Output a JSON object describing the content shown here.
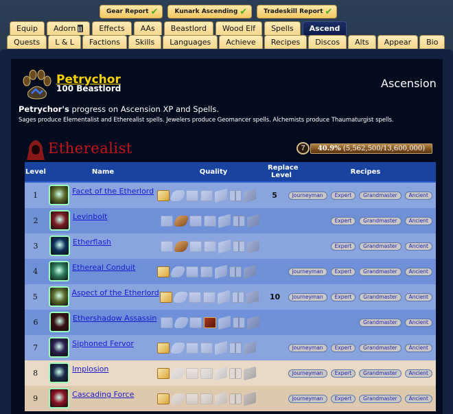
{
  "reports": [
    {
      "label": "Gear Report",
      "status": "check"
    },
    {
      "label": "Kunark Ascending",
      "status": "check"
    },
    {
      "label": "Tradeskill Report",
      "status": "check"
    }
  ],
  "tabs_row1": [
    {
      "label": "Equip"
    },
    {
      "label": "Adorn",
      "icon": "calculator-icon"
    },
    {
      "label": "Effects"
    },
    {
      "label": "AAs"
    },
    {
      "label": "Beastlord"
    },
    {
      "label": "Wood Elf"
    },
    {
      "label": "Spells"
    },
    {
      "label": "Ascend",
      "active": true
    }
  ],
  "tabs_row2": [
    {
      "label": "Quests"
    },
    {
      "label": "L & L"
    },
    {
      "label": "Factions"
    },
    {
      "label": "Skills"
    },
    {
      "label": "Languages"
    },
    {
      "label": "Achieve"
    },
    {
      "label": "Recipes"
    },
    {
      "label": "Discos"
    },
    {
      "label": "Alts"
    },
    {
      "label": "Appear"
    },
    {
      "label": "Bio"
    }
  ],
  "character": {
    "name": "Petrychor",
    "subtitle": "100 Beastlord"
  },
  "page_title": "Ascension",
  "progress_line": {
    "owner": "Petrychor's",
    "rest": " progress on Ascension XP and Spells."
  },
  "description": "Sages produce Elementalist and Etherealist spells. Jewelers produce Geomancer spells. Alchemists produce Thaumaturgist spells.",
  "ascension_class": {
    "name": "Etherealist",
    "level": "7",
    "xp_percent_label": "40.9%",
    "xp_detail": "(5,562,500/13,600,000)",
    "xp_fraction": 0.409
  },
  "table": {
    "headers": {
      "level": "Level",
      "name": "Name",
      "quality": "Quality",
      "replace": "Replace Level",
      "recipes": "Recipes"
    },
    "quality_icons": [
      "scroll-icon",
      "roll-icon",
      "tome-icon",
      "parchment-icon",
      "tablet-icon",
      "book-icon",
      "slab-icon"
    ],
    "rows": [
      {
        "level": "1",
        "name": "Facet of the Etherlord",
        "quality": 0,
        "replace": "5",
        "recipes": [
          "Journeyman",
          "Expert",
          "Grandmaster",
          "Ancient"
        ],
        "shade": "a",
        "icon_color": "#5a6a2a"
      },
      {
        "level": "2",
        "name": "Levinbolt",
        "quality": 1,
        "replace": "",
        "recipes": [
          "Expert",
          "Grandmaster",
          "Ancient"
        ],
        "shade": "b",
        "icon_color": "#7a1a20"
      },
      {
        "level": "3",
        "name": "Etherflash",
        "quality": 1,
        "replace": "",
        "recipes": [
          "Expert",
          "Grandmaster",
          "Ancient"
        ],
        "shade": "a",
        "icon_color": "#10305a"
      },
      {
        "level": "4",
        "name": "Ethereal Conduit",
        "quality": 0,
        "replace": "",
        "recipes": [
          "Journeyman",
          "Expert",
          "Grandmaster",
          "Ancient"
        ],
        "shade": "b",
        "icon_color": "#2a7a5a"
      },
      {
        "level": "5",
        "name": "Aspect of the Etherlord",
        "quality": 0,
        "replace": "10",
        "recipes": [
          "Journeyman",
          "Expert",
          "Grandmaster",
          "Ancient"
        ],
        "shade": "a",
        "icon_color": "#5a6a2a"
      },
      {
        "level": "6",
        "name": "Ethershadow Assassin",
        "quality": 3,
        "replace": "",
        "recipes": [
          "Grandmaster",
          "Ancient"
        ],
        "shade": "b",
        "icon_color": "#3a1010"
      },
      {
        "level": "7",
        "name": "Siphoned Fervor",
        "quality": 0,
        "replace": "",
        "recipes": [
          "Journeyman",
          "Expert",
          "Grandmaster",
          "Ancient"
        ],
        "shade": "a",
        "icon_color": "#2a2050"
      },
      {
        "level": "8",
        "name": "Implosion",
        "quality": 0,
        "replace": "",
        "recipes": [
          "Journeyman",
          "Expert",
          "Grandmaster",
          "Ancient"
        ],
        "shade": "c",
        "icon_color": "#1a2a4a"
      },
      {
        "level": "9",
        "name": "Cascading Force",
        "quality": 0,
        "replace": "",
        "recipes": [
          "Journeyman",
          "Expert",
          "Grandmaster",
          "Ancient"
        ],
        "shade": "d",
        "icon_color": "#8a1020"
      }
    ]
  }
}
